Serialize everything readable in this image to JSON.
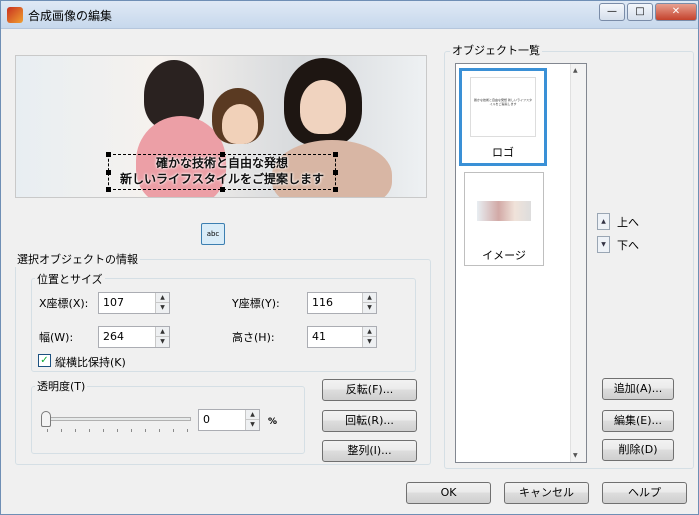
{
  "window": {
    "title": "合成画像の編集",
    "minimize_glyph": "—",
    "maximize_glyph": "□",
    "close_glyph": "✕"
  },
  "preview": {
    "caption_line1": "確かな技術と自由な発想",
    "caption_line2": "新しいライフスタイルをご提案します"
  },
  "toolbar": {
    "text_tool_label": "abc"
  },
  "selected_object": {
    "group_title": "選択オブジェクトの情報",
    "position_size": {
      "group_title": "位置とサイズ",
      "x_label": "X座標(X):",
      "x_value": "107",
      "y_label": "Y座標(Y):",
      "y_value": "116",
      "width_label": "幅(W):",
      "width_value": "264",
      "height_label": "高さ(H):",
      "height_value": "41",
      "keep_ratio_label": "縦横比保持(K)",
      "keep_ratio_checked": true
    },
    "transparency": {
      "group_title": "透明度(T)",
      "value": "0",
      "unit": "%",
      "slider_level": 0
    }
  },
  "actions": {
    "flip": "反転(F)...",
    "rotate": "回転(R)...",
    "align": "整列(I)..."
  },
  "object_list": {
    "group_title": "オブジェクト一覧",
    "items": [
      {
        "label": "ロゴ",
        "selected": true,
        "thumb_text": "確かな技術と自由な発想 新しいライフスタイルをご提案します"
      },
      {
        "label": "イメージ",
        "selected": false
      }
    ],
    "move_up": "上へ",
    "move_down": "下へ",
    "add": "追加(A)...",
    "edit": "編集(E)...",
    "delete": "削除(D)"
  },
  "footer": {
    "ok": "OK",
    "cancel": "キャンセル",
    "help": "ヘルプ"
  },
  "icons": {
    "up_arrow": "▲",
    "down_arrow": "▼",
    "check": "✓"
  }
}
